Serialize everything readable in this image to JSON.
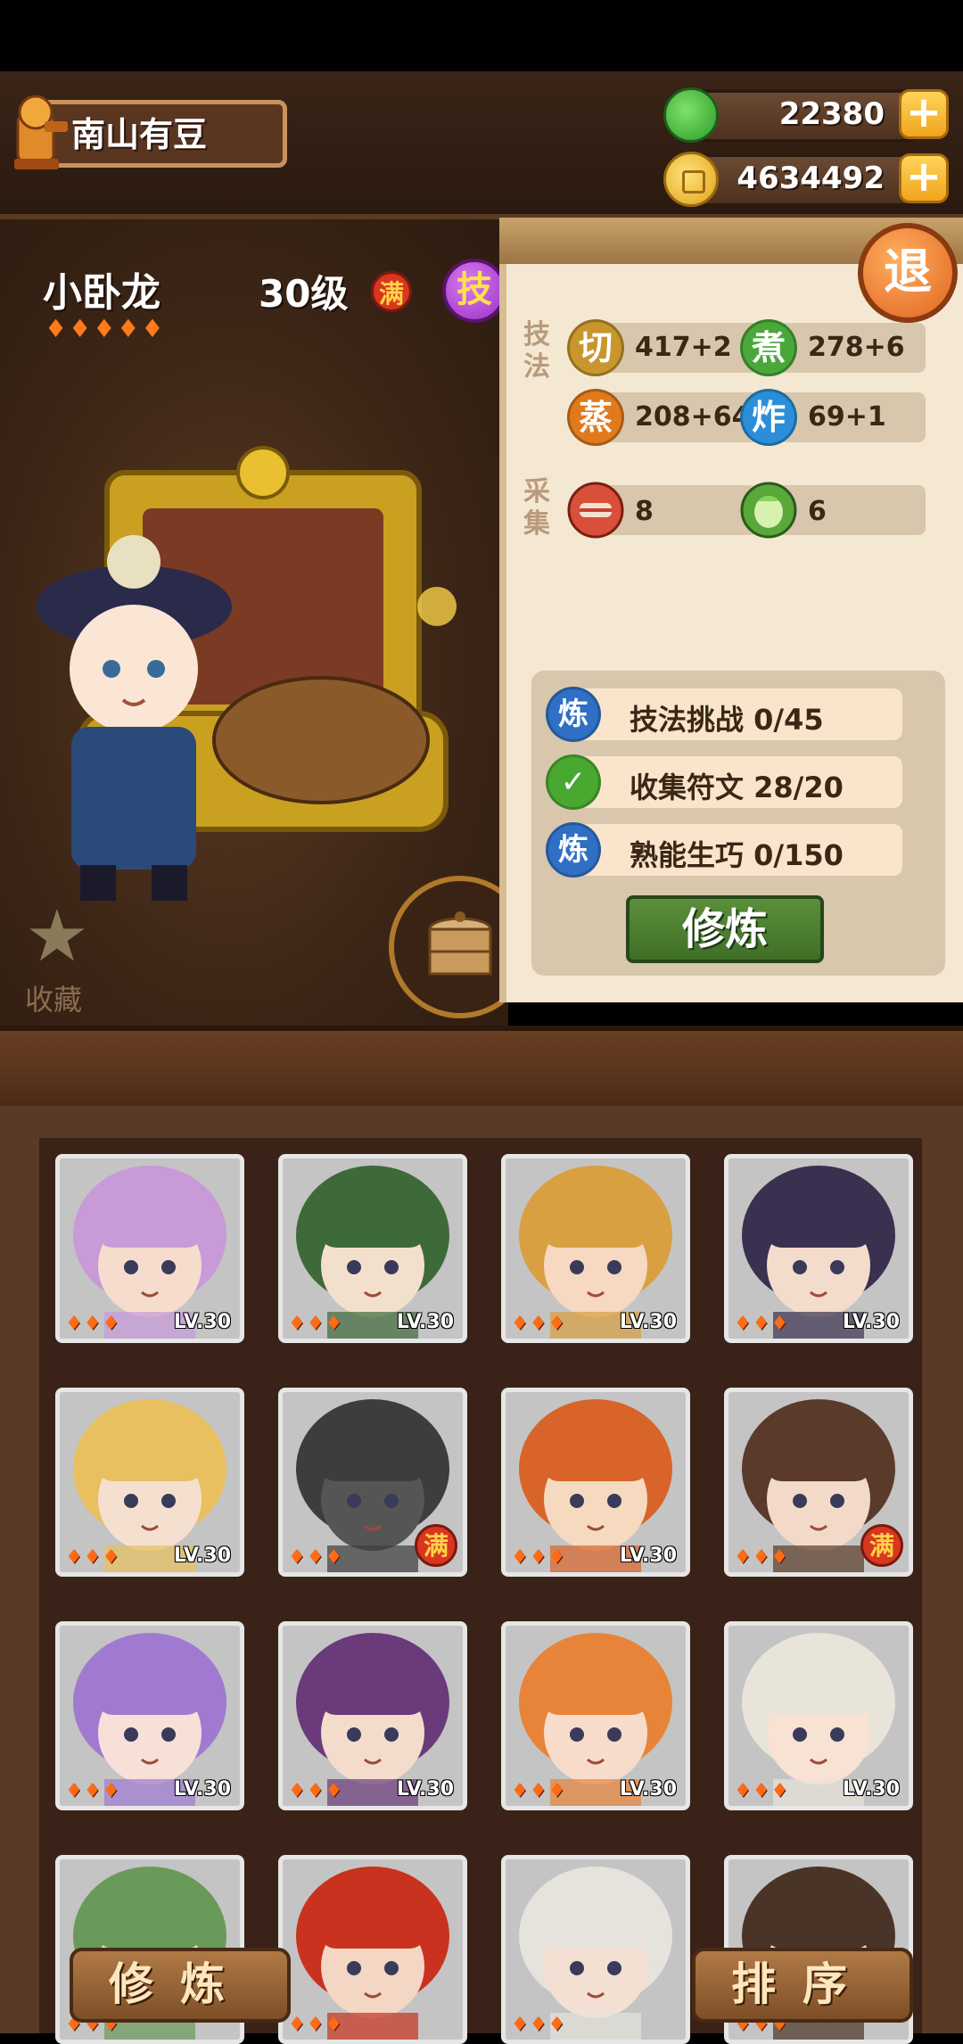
{
  "player": {
    "name": "南山有豆"
  },
  "resources": {
    "jade": {
      "value": "22380",
      "icon": "jade-icon"
    },
    "coins": {
      "value": "4634492",
      "icon": "coin-icon"
    },
    "plus_label": "+"
  },
  "character": {
    "name": "小卧龙",
    "level": "30级",
    "max_badge": "满",
    "skill_badge": "技",
    "fire_count": 5
  },
  "panel": {
    "exit_label": "退",
    "techniques_label": "技法",
    "gather_label": "采集",
    "stats": [
      {
        "icon_label": "切",
        "value": "417+2",
        "color": "#c8962d"
      },
      {
        "icon_label": "煮",
        "value": "278+6",
        "color": "#4aa83a"
      },
      {
        "icon_label": "蒸",
        "value": "208+64",
        "color": "#e07a1c"
      },
      {
        "icon_label": "炸",
        "value": "69+1",
        "color": "#2a8fd8"
      }
    ],
    "gather": [
      {
        "icon": "meat-icon",
        "value": "8"
      },
      {
        "icon": "vegetable-icon",
        "value": "6"
      }
    ],
    "training": [
      {
        "icon_label": "炼",
        "text": "技法挑战 0/45",
        "color": "#2f6fc4"
      },
      {
        "icon_label": "✓",
        "text": "收集符文 28/20",
        "color": "#48a82f"
      },
      {
        "icon_label": "炼",
        "text": "熟能生巧 0/150",
        "color": "#2f6fc4"
      }
    ],
    "cultivate_button": "修炼"
  },
  "favorite_label": "收藏",
  "roster": [
    {
      "hair": "#c89ad8",
      "skin": "#f6dccd",
      "badge": "LV.30",
      "is_max": false
    },
    {
      "hair": "#3e6a3a",
      "skin": "#f3e0cc",
      "badge": "LV.30",
      "is_max": false
    },
    {
      "hair": "#d8a040",
      "skin": "#f7d8c0",
      "badge": "LV.30",
      "is_max": false
    },
    {
      "hair": "#3a3050",
      "skin": "#f3dccb",
      "badge": "LV.30",
      "is_max": false
    },
    {
      "hair": "#e8c060",
      "skin": "#f5e0d0",
      "badge": "LV.30",
      "is_max": false
    },
    {
      "hair": "#3d3d3d",
      "skin": "#555555",
      "badge": "满",
      "is_max": true
    },
    {
      "hair": "#d8642a",
      "skin": "#f5dac0",
      "badge": "LV.30",
      "is_max": false
    },
    {
      "hair": "#5a3a2a",
      "skin": "#f3dac8",
      "badge": "满",
      "is_max": true
    },
    {
      "hair": "#a07ad0",
      "skin": "#f6e0d8",
      "badge": "LV.30",
      "is_max": false
    },
    {
      "hair": "#6a3a7a",
      "skin": "#f4dccc",
      "badge": "LV.30",
      "is_max": false
    },
    {
      "hair": "#e8843a",
      "skin": "#f7dccb",
      "badge": "LV.30",
      "is_max": false
    },
    {
      "hair": "#e8e4da",
      "skin": "#f7e2d4",
      "badge": "LV.30",
      "is_max": false
    },
    {
      "hair": "#6a9a5a",
      "skin": "#f3dccb",
      "badge": "",
      "is_max": false
    },
    {
      "hair": "#c8321e",
      "skin": "#f3d6c4",
      "badge": "",
      "is_max": false
    },
    {
      "hair": "#e6e2dc",
      "skin": "#f3e0d2",
      "badge": "",
      "is_max": false
    },
    {
      "hair": "#4a3428",
      "skin": "#f3dccb",
      "badge": "",
      "is_max": false
    }
  ],
  "bottom": {
    "left_button": "修炼",
    "right_button": "排序"
  }
}
